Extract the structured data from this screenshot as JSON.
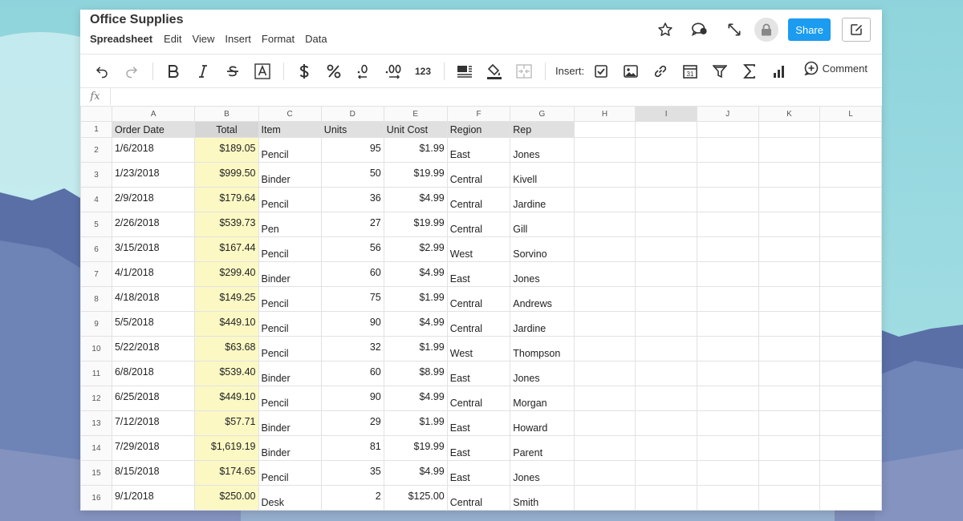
{
  "window": {
    "title": "Office Supplies",
    "menu": [
      "Spreadsheet",
      "Edit",
      "View",
      "Insert",
      "Format",
      "Data"
    ],
    "share_label": "Share"
  },
  "toolbar": {
    "insert_label": "Insert:",
    "comment_label": "Comment",
    "number_format_label": "123"
  },
  "formula": {
    "value": ""
  },
  "sheet": {
    "columns": [
      "A",
      "B",
      "C",
      "D",
      "E",
      "F",
      "G",
      "H",
      "I",
      "J",
      "K",
      "L"
    ],
    "header_row": [
      "Order Date",
      "Total",
      "Item",
      "Units",
      "Unit Cost",
      "Region",
      "Rep"
    ],
    "rows": [
      [
        "1/6/2018",
        "$189.05",
        "Pencil",
        "95",
        "$1.99",
        "East",
        "Jones"
      ],
      [
        "1/23/2018",
        "$999.50",
        "Binder",
        "50",
        "$19.99",
        "Central",
        "Kivell"
      ],
      [
        "2/9/2018",
        "$179.64",
        "Pencil",
        "36",
        "$4.99",
        "Central",
        "Jardine"
      ],
      [
        "2/26/2018",
        "$539.73",
        "Pen",
        "27",
        "$19.99",
        "Central",
        "Gill"
      ],
      [
        "3/15/2018",
        "$167.44",
        "Pencil",
        "56",
        "$2.99",
        "West",
        "Sorvino"
      ],
      [
        "4/1/2018",
        "$299.40",
        "Binder",
        "60",
        "$4.99",
        "East",
        "Jones"
      ],
      [
        "4/18/2018",
        "$149.25",
        "Pencil",
        "75",
        "$1.99",
        "Central",
        "Andrews"
      ],
      [
        "5/5/2018",
        "$449.10",
        "Pencil",
        "90",
        "$4.99",
        "Central",
        "Jardine"
      ],
      [
        "5/22/2018",
        "$63.68",
        "Pencil",
        "32",
        "$1.99",
        "West",
        "Thompson"
      ],
      [
        "6/8/2018",
        "$539.40",
        "Binder",
        "60",
        "$8.99",
        "East",
        "Jones"
      ],
      [
        "6/25/2018",
        "$449.10",
        "Pencil",
        "90",
        "$4.99",
        "Central",
        "Morgan"
      ],
      [
        "7/12/2018",
        "$57.71",
        "Binder",
        "29",
        "$1.99",
        "East",
        "Howard"
      ],
      [
        "7/29/2018",
        "$1,619.19",
        "Binder",
        "81",
        "$19.99",
        "East",
        "Parent"
      ],
      [
        "8/15/2018",
        "$174.65",
        "Pencil",
        "35",
        "$4.99",
        "East",
        "Jones"
      ],
      [
        "9/1/2018",
        "$250.00",
        "Desk",
        "2",
        "$125.00",
        "Central",
        "Smith"
      ]
    ],
    "selected_column": "I",
    "highlight_color": "#fbf8c4"
  },
  "icons": {
    "title_actions": [
      "star-icon",
      "chat-icon",
      "expand-icon",
      "lock-icon",
      "edit-icon"
    ],
    "toolbar": [
      "undo-icon",
      "redo-icon",
      "bold-icon",
      "italic-icon",
      "strikethrough-icon",
      "text-color-icon",
      "currency-icon",
      "percent-icon",
      "decrease-decimal-icon",
      "increase-decimal-icon",
      "number-format-icon",
      "align-icon",
      "fill-color-icon",
      "merge-cells-icon",
      "checkbox-icon",
      "image-icon",
      "link-icon",
      "calendar-icon",
      "filter-icon",
      "sum-icon",
      "chart-icon",
      "comment-icon"
    ]
  },
  "colors": {
    "accent": "#1b9cf0"
  }
}
